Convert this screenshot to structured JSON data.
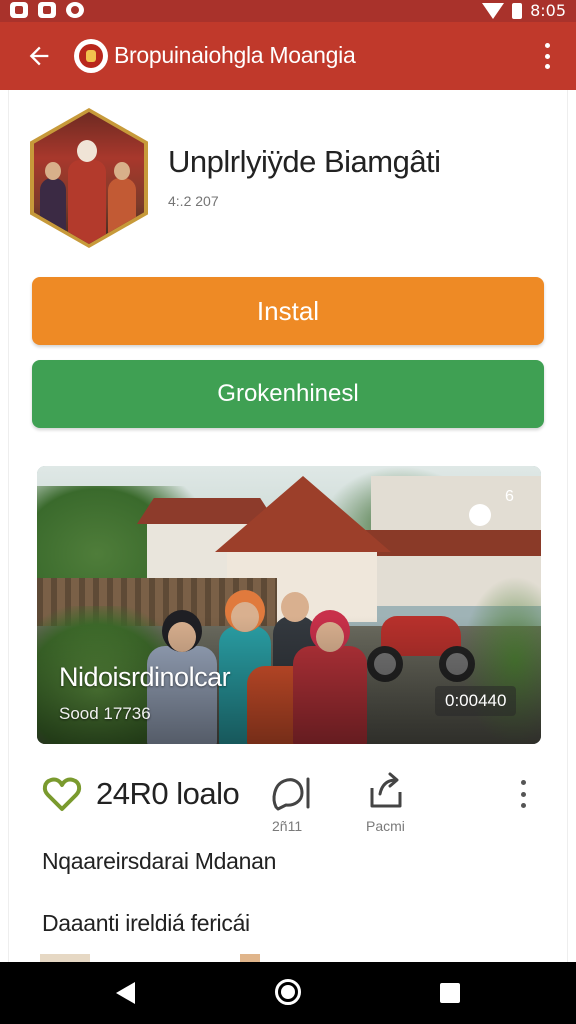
{
  "status_bar": {
    "time": "8:05",
    "icons": [
      "notification-icon",
      "photo-icon",
      "sync-icon",
      "wifi-icon",
      "battery-icon"
    ]
  },
  "app_bar": {
    "title": "Bropuinaiohgla Moangia",
    "back_icon": "arrow-left-icon",
    "menu_icon": "more-vertical-icon"
  },
  "app": {
    "name": "Unplrlyiÿde Biamgâti",
    "meta": "4:.2 207"
  },
  "buttons": {
    "install": "Instal",
    "secondary": "Grokenhinesl"
  },
  "hero": {
    "title": "Nidoisrdinolcar",
    "subtitle": "Sood 17736",
    "duration": "0:00440",
    "toggle_label": "6"
  },
  "actions": {
    "like_count": "24R0 loalo",
    "comment_count": "2ñ11",
    "share_label": "Pacmi"
  },
  "section": {
    "title": "Nqaareirsdarai Mdanan",
    "text": "Daaanti ireldiá fericái"
  },
  "colors": {
    "app_bar": "#c0392b",
    "status_bar": "#a9322b",
    "install_button": "#ee8a25",
    "secondary_button": "#3fa053",
    "like_icon": "#7a9a2e"
  }
}
